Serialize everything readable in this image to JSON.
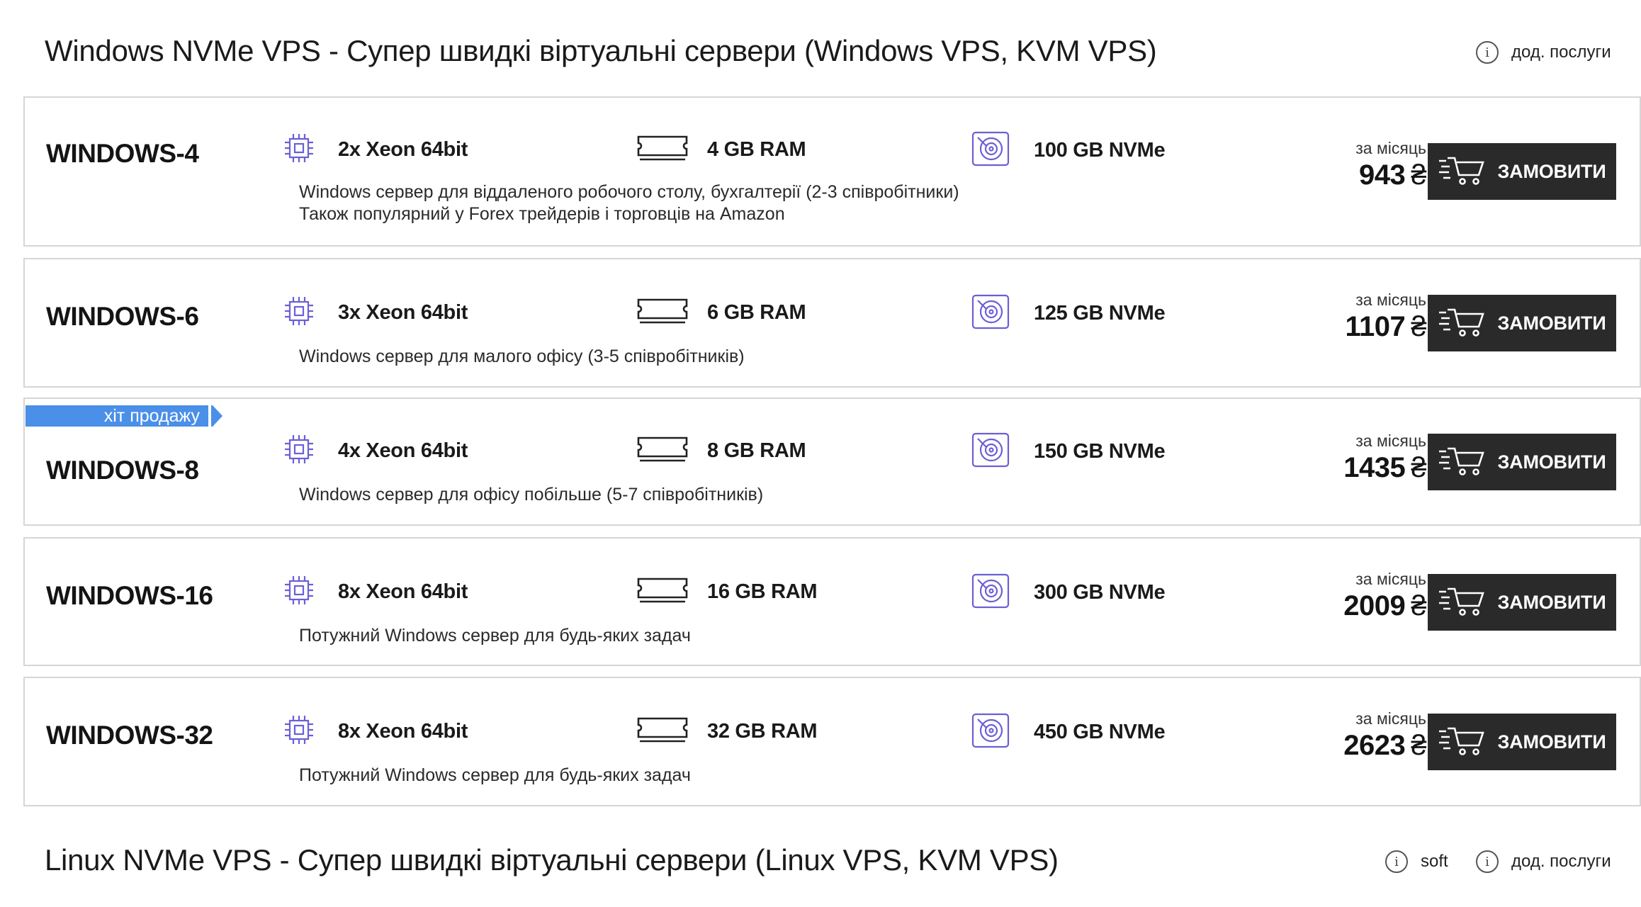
{
  "windows_section": {
    "title": "Windows NVMe VPS - Супер швидкі віртуальні сервери (Windows VPS, KVM VPS)",
    "extra_services": "дод. послуги",
    "plans": [
      {
        "name": "WINDOWS-4",
        "cpu": "2x Xeon 64bit",
        "ram": "4 GB RAM",
        "disk": "100 GB NVMe",
        "desc1": "Windows сервер для віддаленого робочого столу, бухгалтерії (2-3 співробітники)",
        "desc2": "Також популярний у Forex трейдерів і торговців на Amazon",
        "per_month": "за місяць",
        "price": "943",
        "currency": "₴",
        "order": "ЗАМОВИТИ"
      },
      {
        "name": "WINDOWS-6",
        "cpu": "3x Xeon 64bit",
        "ram": "6 GB RAM",
        "disk": "125 GB NVMe",
        "desc1": "Windows сервер для малого офісу (3-5 співробітників)",
        "per_month": "за місяць",
        "price": "1107",
        "currency": "₴",
        "order": "ЗАМОВИТИ"
      },
      {
        "name": "WINDOWS-8",
        "badge": "хіт продажу",
        "cpu": "4x Xeon 64bit",
        "ram": "8 GB RAM",
        "disk": "150 GB NVMe",
        "desc1": "Windows сервер для офісу побільше (5-7 співробітників)",
        "per_month": "за місяць",
        "price": "1435",
        "currency": "₴",
        "order": "ЗАМОВИТИ"
      },
      {
        "name": "WINDOWS-16",
        "cpu": "8x Xeon 64bit",
        "ram": "16 GB RAM",
        "disk": "300 GB NVMe",
        "desc1": "Потужний Windows сервер для будь-яких задач",
        "per_month": "за місяць",
        "price": "2009",
        "currency": "₴",
        "order": "ЗАМОВИТИ"
      },
      {
        "name": "WINDOWS-32",
        "cpu": "8x Xeon 64bit",
        "ram": "32 GB RAM",
        "disk": "450 GB NVMe",
        "desc1": "Потужний Windows сервер для будь-яких задач",
        "per_month": "за місяць",
        "price": "2623",
        "currency": "₴",
        "order": "ЗАМОВИТИ"
      }
    ]
  },
  "linux_section": {
    "title": "Linux NVMe VPS - Супер швидкі віртуальні сервери (Linux VPS, KVM VPS)",
    "soft": "soft",
    "extra_services": "дод. послуги"
  },
  "icons": {
    "cpu": "cpu-chip-icon",
    "ram": "ram-module-icon",
    "disk": "disk-drive-icon",
    "cart": "shopping-cart-icon",
    "info": "info-icon"
  },
  "colors": {
    "accent_icon": "#6b5fd6",
    "badge": "#4a8fe8",
    "button": "#2a2a2a"
  }
}
